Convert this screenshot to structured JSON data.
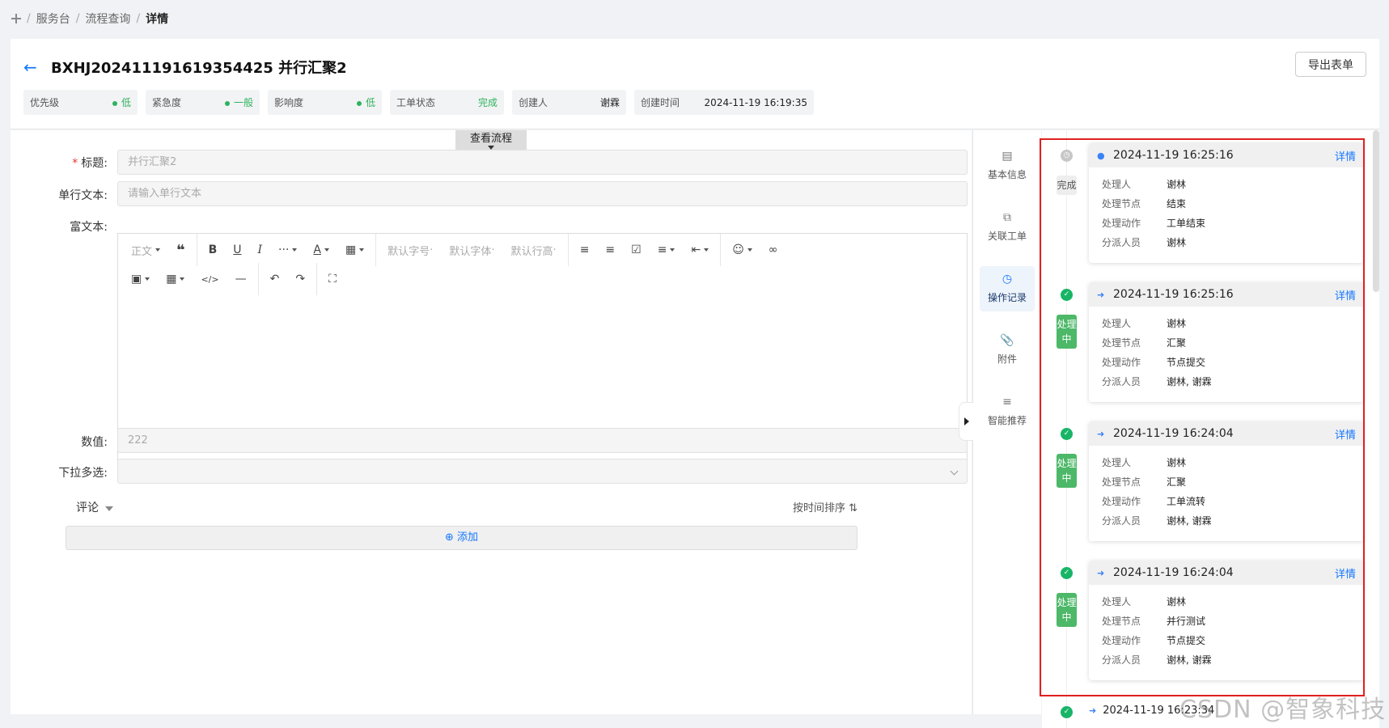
{
  "breadcrumb": {
    "items": [
      "服务台",
      "流程查询"
    ],
    "current": "详情"
  },
  "header": {
    "title": "BXHJ202411191619354425 并行汇聚2",
    "export_label": "导出表单",
    "tags": [
      {
        "label": "优先级",
        "value": "低",
        "dot": true
      },
      {
        "label": "紧急度",
        "value": "一般",
        "dot": true
      },
      {
        "label": "影响度",
        "value": "低",
        "dot": true
      },
      {
        "label": "工单状态",
        "value": "完成",
        "dot": false
      },
      {
        "label": "创建人",
        "value": "谢霖",
        "dot": false
      },
      {
        "label": "创建时间",
        "value": "2024-11-19 16:19:35",
        "dot": false
      }
    ]
  },
  "form": {
    "flow_button": "查看流程",
    "title_label": "标题:",
    "title_value": "并行汇聚2",
    "single_line_label": "单行文本:",
    "single_line_placeholder": "请输入单行文本",
    "richtext_label": "富文本:",
    "toolbar": {
      "paragraph": "正文",
      "font_size": "默认字号",
      "font_family": "默认字体",
      "line_height": "默认行高"
    },
    "number_label": "数值:",
    "number_value": "222",
    "dropdown_label": "下拉多选:",
    "comment_label": "评论",
    "sort_label": "按时间排序",
    "add_label": "添加"
  },
  "side_tabs": [
    {
      "label": "基本信息",
      "icon": "document-icon",
      "active": false
    },
    {
      "label": "关联工单",
      "icon": "link-icon",
      "active": false
    },
    {
      "label": "操作记录",
      "icon": "history-icon",
      "active": true
    },
    {
      "label": "附件",
      "icon": "paperclip-icon",
      "active": false
    },
    {
      "label": "智能推荐",
      "icon": "search-list-icon",
      "active": false
    }
  ],
  "timeline": {
    "keys": {
      "handler": "处理人",
      "node": "处理节点",
      "action": "处理动作",
      "assignee": "分派人员"
    },
    "detail_label": "详情",
    "entries": [
      {
        "status": "完成",
        "status_color": "gray",
        "time": "2024-11-19 16:25:16",
        "handler": "谢林",
        "node": "结束",
        "action": "工单结束",
        "assignee": "谢林"
      },
      {
        "status": "处理中",
        "status_color": "green",
        "time": "2024-11-19 16:25:16",
        "handler": "谢林",
        "node": "汇聚",
        "action": "节点提交",
        "assignee": "谢林, 谢霖"
      },
      {
        "status": "处理中",
        "status_color": "green",
        "time": "2024-11-19 16:24:04",
        "handler": "谢林",
        "node": "汇聚",
        "action": "工单流转",
        "assignee": "谢林, 谢霖"
      },
      {
        "status": "处理中",
        "status_color": "green",
        "time": "2024-11-19 16:24:04",
        "handler": "谢林",
        "node": "并行测试",
        "action": "节点提交",
        "assignee": "谢林, 谢霖"
      }
    ],
    "next_time": "2024-11-19 16:23:34"
  },
  "watermark": "CSDN @智象科技",
  "colors": {
    "accent": "#1677ff",
    "success": "#18b566",
    "highlight": "#e02020"
  }
}
